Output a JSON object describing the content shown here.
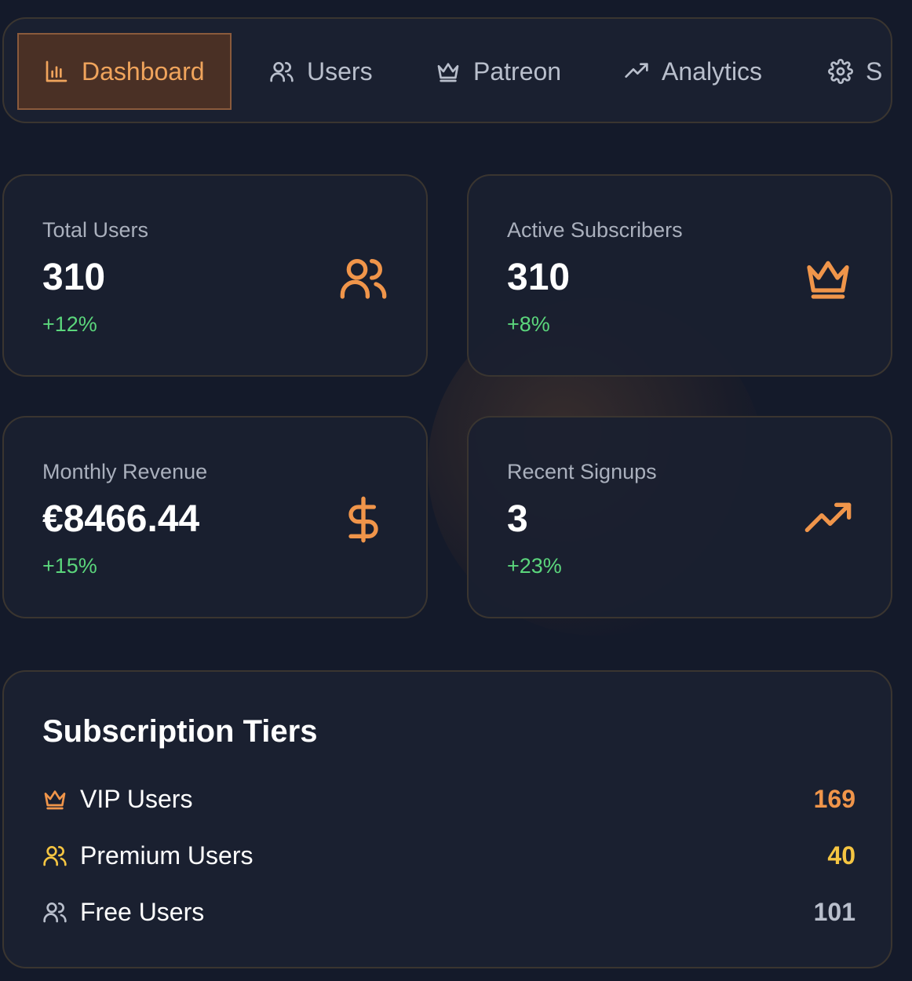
{
  "nav": {
    "items": [
      {
        "label": "Dashboard",
        "icon": "bar-chart-icon",
        "active": true
      },
      {
        "label": "Users",
        "icon": "users-icon",
        "active": false
      },
      {
        "label": "Patreon",
        "icon": "crown-icon",
        "active": false
      },
      {
        "label": "Analytics",
        "icon": "trending-up-icon",
        "active": false
      },
      {
        "label": "S",
        "icon": "gear-icon",
        "active": false
      }
    ]
  },
  "stats": [
    {
      "label": "Total Users",
      "value": "310",
      "change": "+12%",
      "icon": "users-icon"
    },
    {
      "label": "Active Subscribers",
      "value": "310",
      "change": "+8%",
      "icon": "crown-icon"
    },
    {
      "label": "Monthly Revenue",
      "value": "€8466.44",
      "change": "+15%",
      "icon": "dollar-icon"
    },
    {
      "label": "Recent Signups",
      "value": "3",
      "change": "+23%",
      "icon": "trending-up-icon"
    }
  ],
  "tiers": {
    "title": "Subscription Tiers",
    "rows": [
      {
        "label": "VIP Users",
        "count": "169",
        "icon": "crown-icon",
        "color": "#f0954a"
      },
      {
        "label": "Premium Users",
        "count": "40",
        "icon": "users-icon",
        "color": "#f5c542"
      },
      {
        "label": "Free Users",
        "count": "101",
        "icon": "users-icon",
        "color": "#b9bfcc"
      }
    ]
  },
  "colors": {
    "accent": "#f0954a",
    "positive": "#5bd67c",
    "background": "#141a2a",
    "card": "#1a2030"
  }
}
